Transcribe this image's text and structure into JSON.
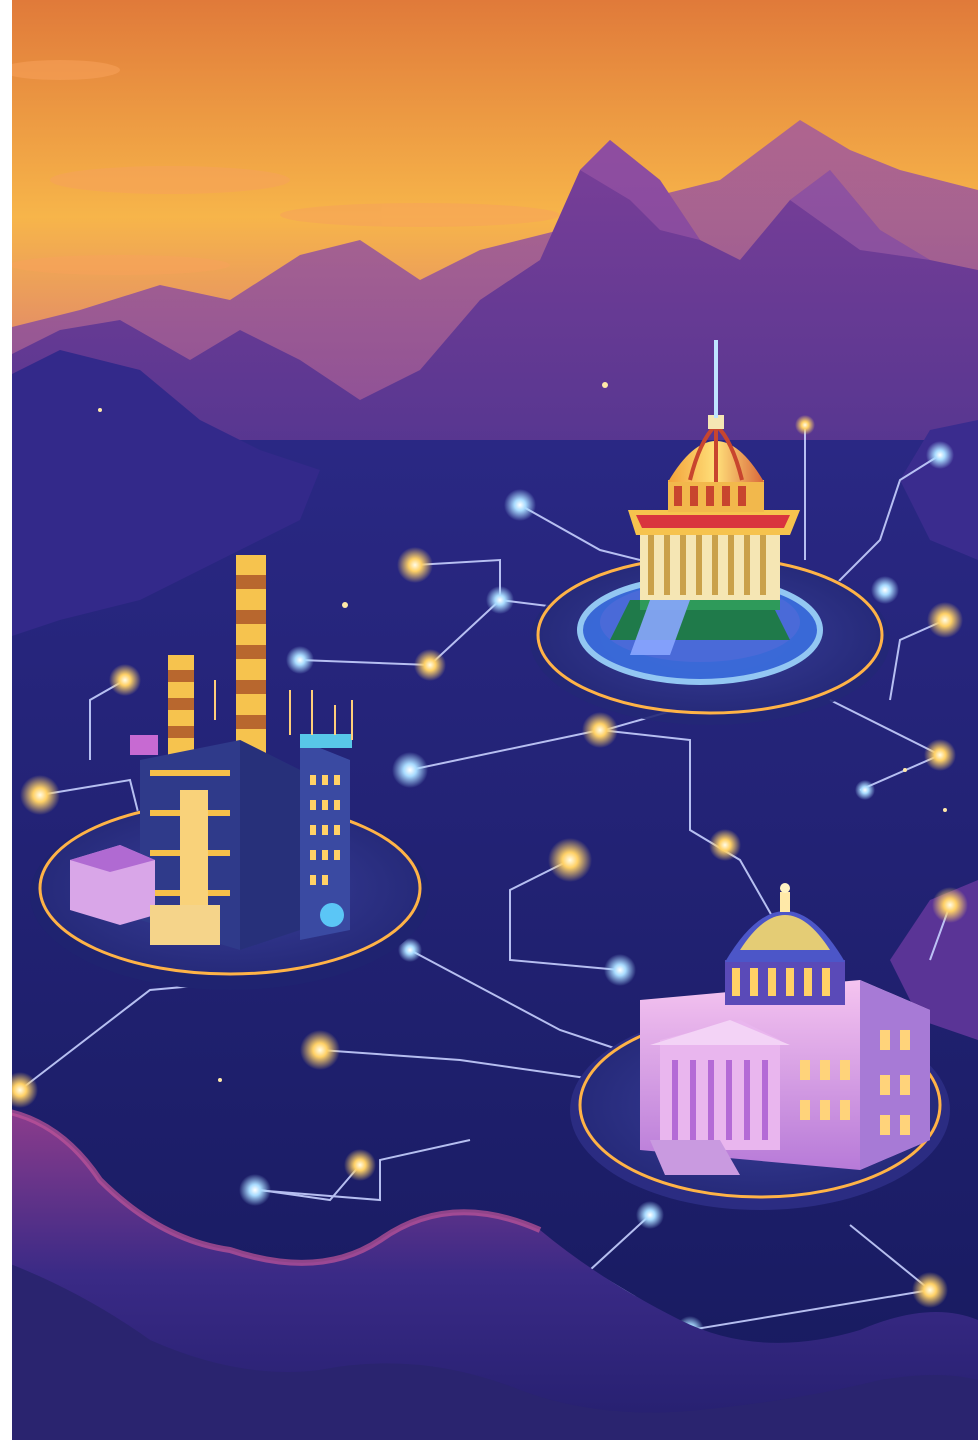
{
  "scene": {
    "subjects": [
      "factory",
      "capitol-dome-building",
      "government-building",
      "mountains",
      "sunset-sky",
      "glowing-network"
    ],
    "colors": {
      "sky_top": "#e98a3b",
      "sky_mid": "#f6b24b",
      "sky_low": "#c7628a",
      "mountain_far": "#8a4f9a",
      "mountain_mid": "#5b3a96",
      "mountain_near": "#2c2a7a",
      "ground": "#1c1f6e",
      "glow": "#ffd166",
      "glow_blue": "#9fd8ff",
      "line": "#b9c6ff",
      "platform_ring": "#ffb347"
    }
  }
}
